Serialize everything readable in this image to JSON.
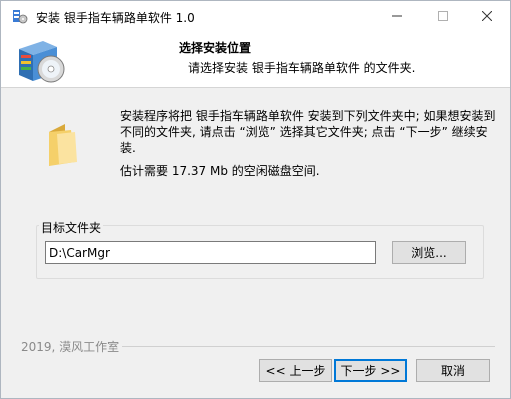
{
  "window": {
    "title": "安装 银手指车辆路单软件 1.0",
    "icon": "installer-icon"
  },
  "titlebar_controls": {
    "minimize_icon": "minimize-icon",
    "maximize_icon": "maximize-icon",
    "close_icon": "close-icon"
  },
  "header": {
    "title": "选择安装位置",
    "subtitle": "请选择安装 银手指车辆路单软件 的文件夹.",
    "icon": "install-box-cd-icon"
  },
  "body": {
    "description": "安装程序将把 银手指车辆路单软件 安装到下列文件夹中; 如果想安装到不同的文件夹, 请点击 “浏览” 选择其它文件夹; 点击 “下一步” 继续安装.",
    "space_required": "估计需要 17.37 Mb 的空闲磁盘空间.",
    "folder_icon": "folder-icon"
  },
  "destination": {
    "group_label": "目标文件夹",
    "path_value": "D:\\CarMgr",
    "browse_label": "浏览..."
  },
  "footer": {
    "branding": "2019, 漠风工作室",
    "back_label": "<< 上一步",
    "next_label": "下一步 >>",
    "cancel_label": "取消"
  },
  "colors": {
    "dialog_bg": "#f0f0f0",
    "header_bg": "#ffffff",
    "default_button_border": "#0078d7"
  }
}
